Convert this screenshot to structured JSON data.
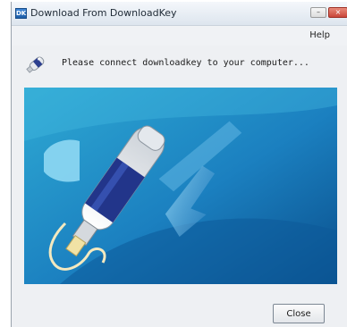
{
  "window": {
    "title": "Download From DownloadKey",
    "app_icon_label": "DK"
  },
  "titlebar_buttons": {
    "minimize_label": "–",
    "close_label": "×"
  },
  "menu": {
    "help_label": "Help"
  },
  "status": {
    "icon": "usb-key-icon",
    "message": "Please connect downloadkey to your computer..."
  },
  "illustration": {
    "icon": "usb-key-connect-illustration",
    "colors": {
      "background_light": "#2ea9d3",
      "background_dark": "#0a4f8c",
      "arrow": "#5fb6e6"
    }
  },
  "footer": {
    "close_label": "Close"
  }
}
